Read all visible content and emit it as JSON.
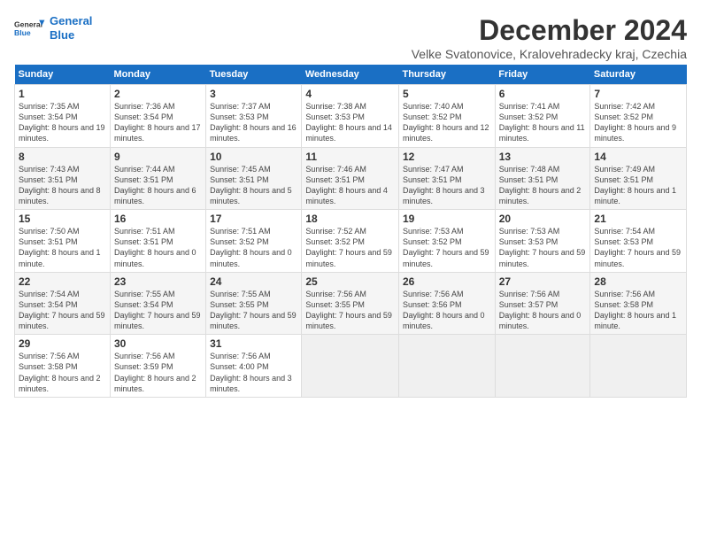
{
  "logo": {
    "line1": "General",
    "line2": "Blue"
  },
  "title": "December 2024",
  "subtitle": "Velke Svatonovice, Kralovehradecky kraj, Czechia",
  "days_header": [
    "Sunday",
    "Monday",
    "Tuesday",
    "Wednesday",
    "Thursday",
    "Friday",
    "Saturday"
  ],
  "weeks": [
    [
      {
        "num": "1",
        "rise": "7:35 AM",
        "set": "3:54 PM",
        "daylight": "8 hours and 19 minutes."
      },
      {
        "num": "2",
        "rise": "7:36 AM",
        "set": "3:54 PM",
        "daylight": "8 hours and 17 minutes."
      },
      {
        "num": "3",
        "rise": "7:37 AM",
        "set": "3:53 PM",
        "daylight": "8 hours and 16 minutes."
      },
      {
        "num": "4",
        "rise": "7:38 AM",
        "set": "3:53 PM",
        "daylight": "8 hours and 14 minutes."
      },
      {
        "num": "5",
        "rise": "7:40 AM",
        "set": "3:52 PM",
        "daylight": "8 hours and 12 minutes."
      },
      {
        "num": "6",
        "rise": "7:41 AM",
        "set": "3:52 PM",
        "daylight": "8 hours and 11 minutes."
      },
      {
        "num": "7",
        "rise": "7:42 AM",
        "set": "3:52 PM",
        "daylight": "8 hours and 9 minutes."
      }
    ],
    [
      {
        "num": "8",
        "rise": "7:43 AM",
        "set": "3:51 PM",
        "daylight": "8 hours and 8 minutes."
      },
      {
        "num": "9",
        "rise": "7:44 AM",
        "set": "3:51 PM",
        "daylight": "8 hours and 6 minutes."
      },
      {
        "num": "10",
        "rise": "7:45 AM",
        "set": "3:51 PM",
        "daylight": "8 hours and 5 minutes."
      },
      {
        "num": "11",
        "rise": "7:46 AM",
        "set": "3:51 PM",
        "daylight": "8 hours and 4 minutes."
      },
      {
        "num": "12",
        "rise": "7:47 AM",
        "set": "3:51 PM",
        "daylight": "8 hours and 3 minutes."
      },
      {
        "num": "13",
        "rise": "7:48 AM",
        "set": "3:51 PM",
        "daylight": "8 hours and 2 minutes."
      },
      {
        "num": "14",
        "rise": "7:49 AM",
        "set": "3:51 PM",
        "daylight": "8 hours and 1 minute."
      }
    ],
    [
      {
        "num": "15",
        "rise": "7:50 AM",
        "set": "3:51 PM",
        "daylight": "8 hours and 1 minute."
      },
      {
        "num": "16",
        "rise": "7:51 AM",
        "set": "3:51 PM",
        "daylight": "8 hours and 0 minutes."
      },
      {
        "num": "17",
        "rise": "7:51 AM",
        "set": "3:52 PM",
        "daylight": "8 hours and 0 minutes."
      },
      {
        "num": "18",
        "rise": "7:52 AM",
        "set": "3:52 PM",
        "daylight": "7 hours and 59 minutes."
      },
      {
        "num": "19",
        "rise": "7:53 AM",
        "set": "3:52 PM",
        "daylight": "7 hours and 59 minutes."
      },
      {
        "num": "20",
        "rise": "7:53 AM",
        "set": "3:53 PM",
        "daylight": "7 hours and 59 minutes."
      },
      {
        "num": "21",
        "rise": "7:54 AM",
        "set": "3:53 PM",
        "daylight": "7 hours and 59 minutes."
      }
    ],
    [
      {
        "num": "22",
        "rise": "7:54 AM",
        "set": "3:54 PM",
        "daylight": "7 hours and 59 minutes."
      },
      {
        "num": "23",
        "rise": "7:55 AM",
        "set": "3:54 PM",
        "daylight": "7 hours and 59 minutes."
      },
      {
        "num": "24",
        "rise": "7:55 AM",
        "set": "3:55 PM",
        "daylight": "7 hours and 59 minutes."
      },
      {
        "num": "25",
        "rise": "7:56 AM",
        "set": "3:55 PM",
        "daylight": "7 hours and 59 minutes."
      },
      {
        "num": "26",
        "rise": "7:56 AM",
        "set": "3:56 PM",
        "daylight": "8 hours and 0 minutes."
      },
      {
        "num": "27",
        "rise": "7:56 AM",
        "set": "3:57 PM",
        "daylight": "8 hours and 0 minutes."
      },
      {
        "num": "28",
        "rise": "7:56 AM",
        "set": "3:58 PM",
        "daylight": "8 hours and 1 minute."
      }
    ],
    [
      {
        "num": "29",
        "rise": "7:56 AM",
        "set": "3:58 PM",
        "daylight": "8 hours and 2 minutes."
      },
      {
        "num": "30",
        "rise": "7:56 AM",
        "set": "3:59 PM",
        "daylight": "8 hours and 2 minutes."
      },
      {
        "num": "31",
        "rise": "7:56 AM",
        "set": "4:00 PM",
        "daylight": "8 hours and 3 minutes."
      },
      null,
      null,
      null,
      null
    ]
  ]
}
